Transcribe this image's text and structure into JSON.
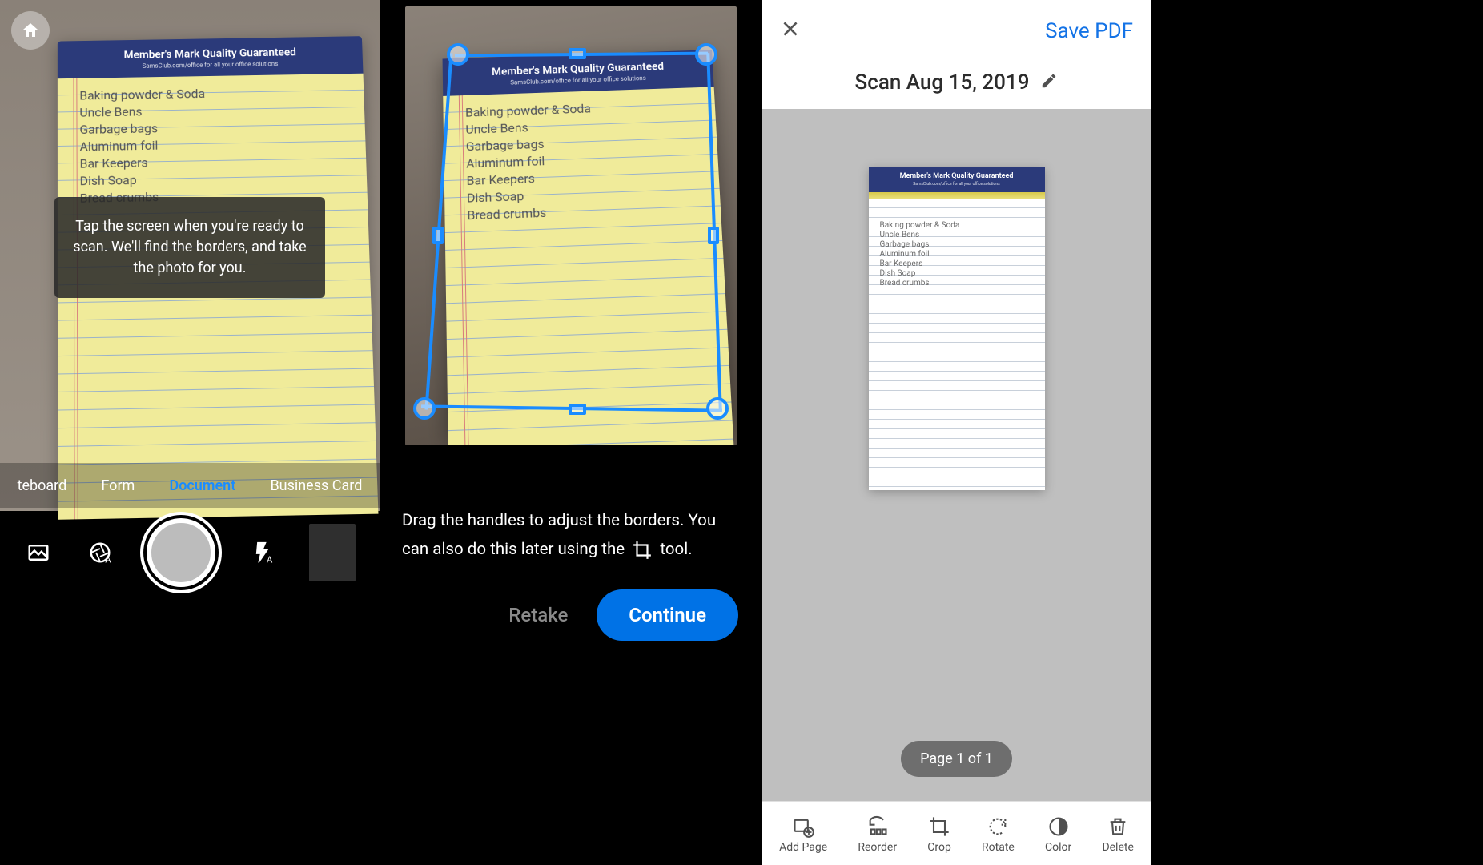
{
  "notepad": {
    "header_title": "Member's Mark Quality Guaranteed",
    "header_sub": "SamsClub.com/office for all your office solutions",
    "lines": [
      "Baking powder & Soda",
      "Uncle Bens",
      "Garbage bags",
      "Aluminum foil",
      "Bar Keepers",
      "Dish Soap",
      "Bread crumbs"
    ]
  },
  "panel1": {
    "tip_text": "Tap the screen when you're ready to scan. We'll find the borders, and take the photo for you.",
    "tabs": [
      "teboard",
      "Form",
      "Document",
      "Business Card"
    ],
    "active_tab": "Document"
  },
  "panel2": {
    "instruction_pre": "Drag the handles to adjust the borders. You can also do this later using the ",
    "instruction_post": " tool.",
    "retake_label": "Retake",
    "continue_label": "Continue"
  },
  "panel3": {
    "save_label": "Save PDF",
    "title": "Scan Aug 15, 2019",
    "page_badge": "Page 1 of 1",
    "toolbar": [
      {
        "label": "Add Page"
      },
      {
        "label": "Reorder"
      },
      {
        "label": "Crop"
      },
      {
        "label": "Rotate"
      },
      {
        "label": "Color"
      },
      {
        "label": "Delete"
      }
    ]
  }
}
